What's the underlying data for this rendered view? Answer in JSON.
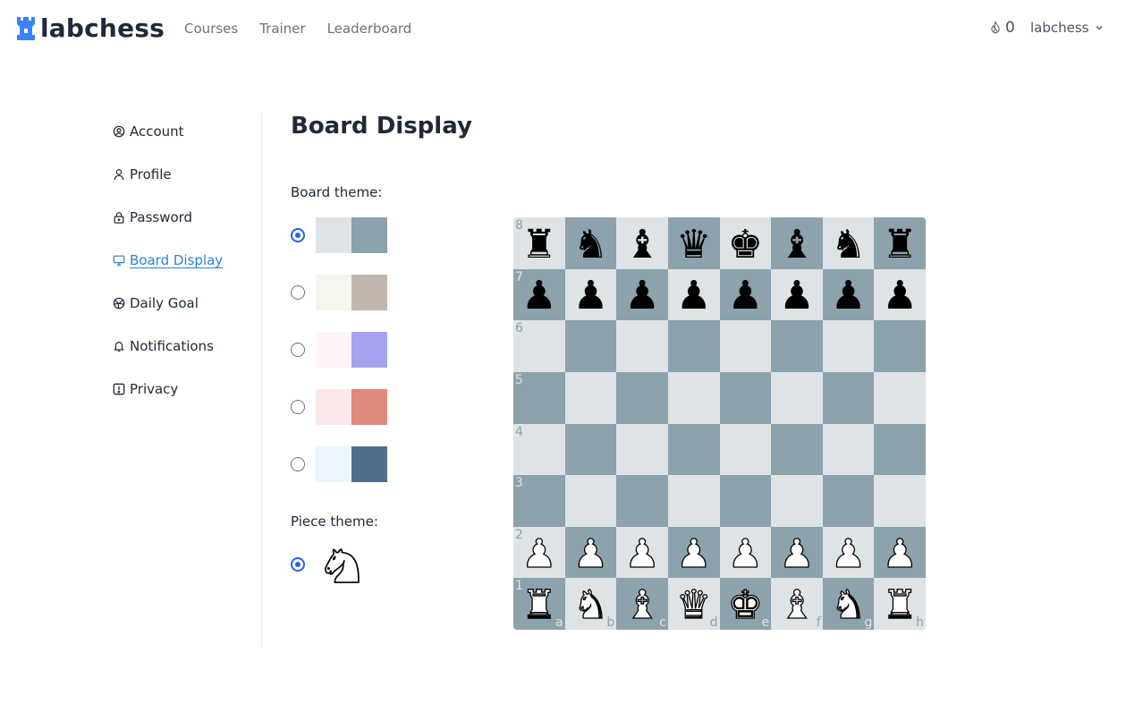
{
  "header": {
    "brand": "labchess",
    "nav": [
      "Courses",
      "Trainer",
      "Leaderboard"
    ],
    "streak_count": "0",
    "username": "labchess",
    "icons": {
      "logo": "rook-icon",
      "streak": "flame-icon",
      "user_menu": "chevron-down-icon"
    }
  },
  "sidebar": {
    "items": [
      {
        "label": "Account",
        "icon": "user-circle-icon",
        "active": false
      },
      {
        "label": "Profile",
        "icon": "user-icon",
        "active": false
      },
      {
        "label": "Password",
        "icon": "lock-icon",
        "active": false
      },
      {
        "label": "Board Display",
        "icon": "monitor-icon",
        "active": true
      },
      {
        "label": "Daily Goal",
        "icon": "target-icon",
        "active": false
      },
      {
        "label": "Notifications",
        "icon": "bell-icon",
        "active": false
      },
      {
        "label": "Privacy",
        "icon": "shield-alert-icon",
        "active": false
      }
    ]
  },
  "main": {
    "title": "Board Display",
    "board_theme_label": "Board theme:",
    "piece_theme_label": "Piece theme:",
    "board_themes": [
      {
        "light": "#dee3e6",
        "dark": "#8ca2ad",
        "selected": true
      },
      {
        "light": "#f7f6ee",
        "dark": "#c1b6ad",
        "selected": false
      },
      {
        "light": "#fff5f9",
        "dark": "#a5a3ef",
        "selected": false
      },
      {
        "light": "#fbe8e8",
        "dark": "#dc8b7c",
        "selected": false
      },
      {
        "light": "#ecf5fe",
        "dark": "#4f6f8d",
        "selected": false
      }
    ],
    "piece_themes": [
      {
        "name": "knight-icon",
        "selected": true
      }
    ]
  },
  "board": {
    "light": "#dee3e6",
    "dark": "#8ca2ad",
    "ranks": [
      "8",
      "7",
      "6",
      "5",
      "4",
      "3",
      "2",
      "1"
    ],
    "files": [
      "a",
      "b",
      "c",
      "d",
      "e",
      "f",
      "g",
      "h"
    ],
    "position": [
      [
        "r",
        "n",
        "b",
        "q",
        "k",
        "b",
        "n",
        "r"
      ],
      [
        "p",
        "p",
        "p",
        "p",
        "p",
        "p",
        "p",
        "p"
      ],
      [
        "",
        "",
        "",
        "",
        "",
        "",
        "",
        ""
      ],
      [
        "",
        "",
        "",
        "",
        "",
        "",
        "",
        ""
      ],
      [
        "",
        "",
        "",
        "",
        "",
        "",
        "",
        ""
      ],
      [
        "",
        "",
        "",
        "",
        "",
        "",
        "",
        ""
      ],
      [
        "P",
        "P",
        "P",
        "P",
        "P",
        "P",
        "P",
        "P"
      ],
      [
        "R",
        "N",
        "B",
        "Q",
        "K",
        "B",
        "N",
        "R"
      ]
    ]
  },
  "colors": {
    "accent": "#2563eb",
    "link_active": "#2f80d1",
    "logo": "#3b82f6"
  }
}
